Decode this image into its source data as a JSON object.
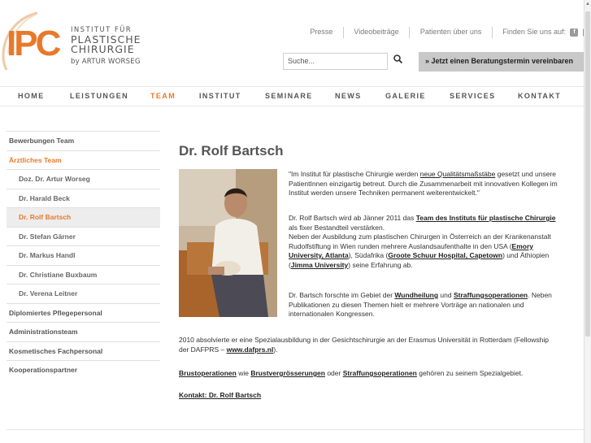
{
  "logo": {
    "mark": "IPC",
    "line1": "INSTITUT FÜR",
    "line2": "PLASTISCHE",
    "line3": "CHIRURGIE",
    "line4": "by ARTUR WORSEG"
  },
  "toplinks": {
    "presse": "Presse",
    "video": "Videobeiträge",
    "patients": "Patienten über uns",
    "find": "Finden Sie uns auf:",
    "social1": "f",
    "social2": "t"
  },
  "search": {
    "placeholder": "Suche..."
  },
  "cta": "» Jetzt einen Beratungstermin vereinbaren",
  "nav": [
    "HOME",
    "LEISTUNGEN",
    "TEAM",
    "INSTITUT",
    "SEMINARE",
    "NEWS",
    "GALERIE",
    "SERVICES",
    "KONTAKT"
  ],
  "sidebar": [
    "Bewerbungen Team",
    "Ärztliches Team",
    "Doz. Dr. Artur Worseg",
    "Dr. Harald Beck",
    "Dr. Rolf Bartsch",
    "Dr. Stefan Gärner",
    "Dr. Markus Handl",
    "Dr. Christiane Buxbaum",
    "Dr. Verena Leitner",
    "Diplomiertes Pflegepersonal",
    "Administrationsteam",
    "Kosmetisches Fachpersonal",
    "Kooperationspartner"
  ],
  "content": {
    "title": "Dr. Rolf Bartsch",
    "quote_1a": "\"Im Institut für plastische Chirurgie werden ",
    "quote_1b": "neue Qualitätsmaßstäbe",
    "quote_1c": " gesetzt und unsere",
    "quote_2": "PatientInnen einzigartig betreut. Durch die Zusammenarbeit mit innovativen Kollegen im",
    "quote_3": "Institut werden unsere Techniken permanent weiterentwickelt.\"",
    "p2_1a": "Dr. Rolf Bartsch wird ab Jänner 2011 das ",
    "p2_1b": "Team des Instituts für plastische Chirurgie",
    "p2_2": "als fixer Bestandteil verstärken.",
    "p2_3": "Neben der Ausbildung zum plastischen Chirurgen in Österreich an der Krankenanstalt",
    "p2_4a": "Rudolfstiftung in Wien runden mehrere Auslandsaufenthalte in den USA (",
    "p2_4b": "Emory",
    "p2_5a": "University, Atlanta",
    "p2_5b": "), Südafrika (",
    "p2_5c": "Groote Schuur Hospital, Capetown",
    "p2_5d": ") und Äthiopien",
    "p2_6a": "(",
    "p2_6b": "Jimma University",
    "p2_6c": ") seine Erfahrung ab.",
    "p3_1a": "Dr. Bartsch forschte im Gebiet der ",
    "p3_1b": "Wundheilung",
    "p3_1c": " und ",
    "p3_1d": "Straffungsoperationen",
    "p3_1e": ". Neben",
    "p3_2": "Publikationen zu diesen Themen hielt er mehrere Vorträge an nationalen und",
    "p3_3": "internationalen Kongressen.",
    "p4_1": "2010 absolvierte er eine Spezialausbildung in der Gesichtschirurgie an der Erasmus Universität in Rotterdam (Fellowship",
    "p4_2a": "der DAFPRS – ",
    "p4_2b": "www.dafprs.nl",
    "p4_2c": ").",
    "p5a": "Brustoperationen",
    "p5b": " wie ",
    "p5c": "Brustvergrösserungen",
    "p5d": " oder ",
    "p5e": "Straffungsoperationen",
    "p5f": " gehören zu seinem Spezialgebiet.",
    "contact": "Kontakt: Dr. Rolf Bartsch"
  },
  "colors": {
    "accent": "#e8792b",
    "text": "#333333",
    "muted": "#555555"
  },
  "icons": [
    "search-icon",
    "facebook-icon",
    "twitter-icon"
  ]
}
